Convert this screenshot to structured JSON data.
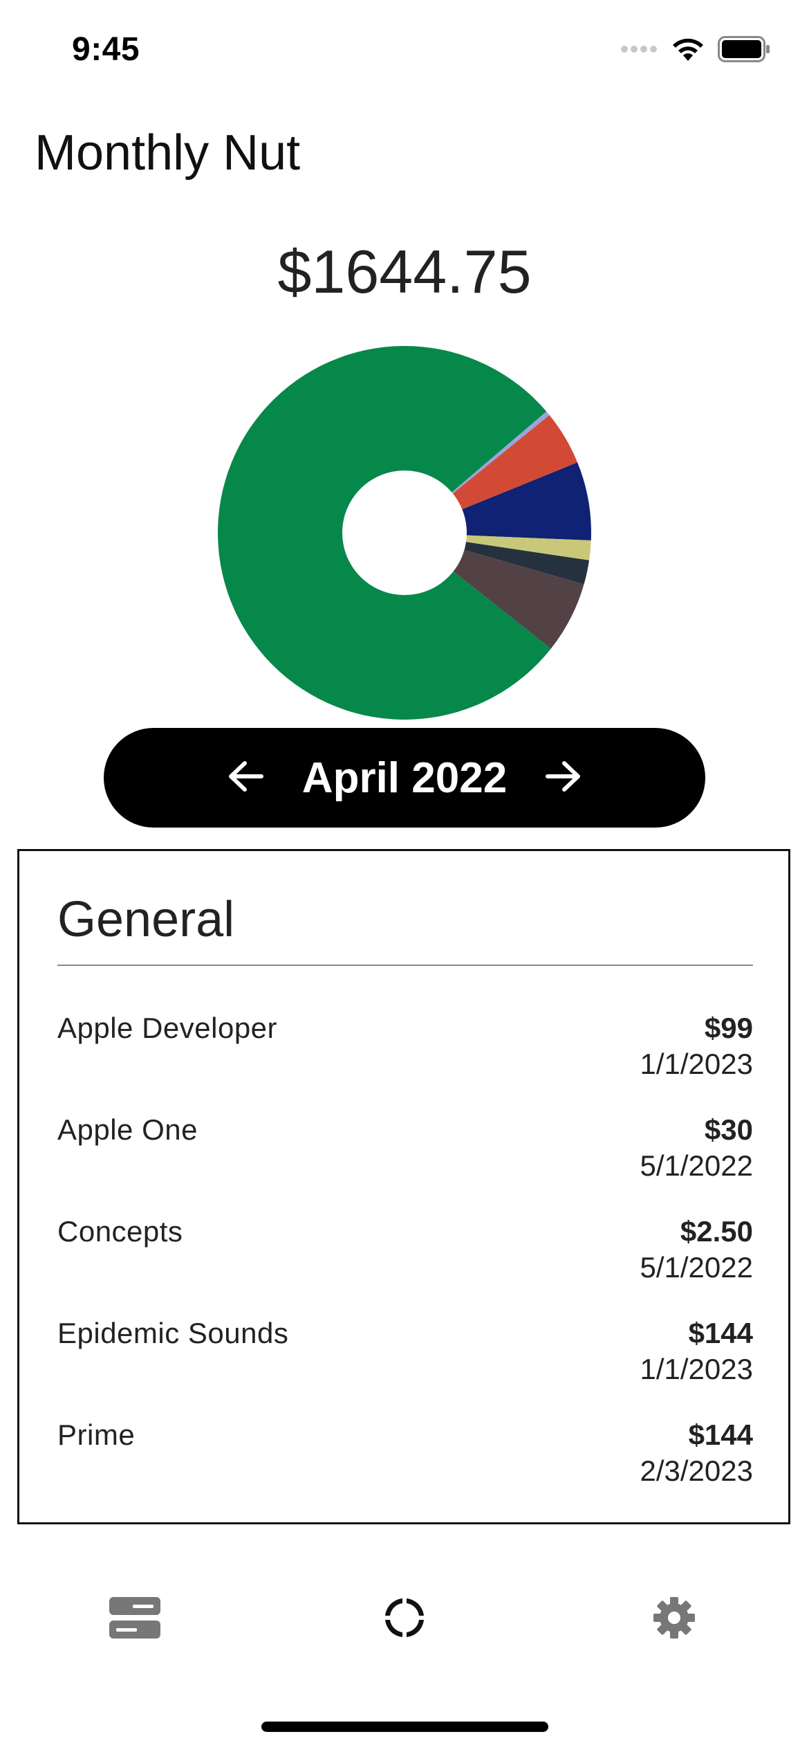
{
  "status_bar": {
    "time": "9:45"
  },
  "header": {
    "title": "Monthly Nut",
    "total": "$1644.75"
  },
  "colors": {
    "nav_pill": "#000000",
    "card_border": "#111111"
  },
  "chart_data": {
    "type": "pie",
    "title": "",
    "donut": true,
    "slices": [
      {
        "value": 78.1,
        "color": "#07884b"
      },
      {
        "value": 0.4,
        "color": "#9ba4de"
      },
      {
        "value": 4.7,
        "color": "#d24a36"
      },
      {
        "value": 6.8,
        "color": "#0f2274"
      },
      {
        "value": 1.7,
        "color": "#c9c878"
      },
      {
        "value": 2.1,
        "color": "#26313f"
      },
      {
        "value": 6.2,
        "color": "#524245"
      }
    ]
  },
  "month_nav": {
    "label": "April 2022",
    "prev_icon": "arrow-left-icon",
    "next_icon": "arrow-right-icon"
  },
  "card": {
    "title": "General",
    "items": [
      {
        "name": "Apple Developer",
        "price": "$99",
        "date": "1/1/2023"
      },
      {
        "name": "Apple One",
        "price": "$30",
        "date": "5/1/2022"
      },
      {
        "name": "Concepts",
        "price": "$2.50",
        "date": "5/1/2022"
      },
      {
        "name": "Epidemic Sounds",
        "price": "$144",
        "date": "1/1/2023"
      },
      {
        "name": "Prime",
        "price": "$144",
        "date": "2/3/2023"
      }
    ]
  },
  "tab_bar": {
    "tabs": [
      {
        "icon": "storage-icon",
        "color": "#777777"
      },
      {
        "icon": "donut-chart-icon",
        "color": "#111111"
      },
      {
        "icon": "gear-icon",
        "color": "#777777"
      }
    ]
  }
}
